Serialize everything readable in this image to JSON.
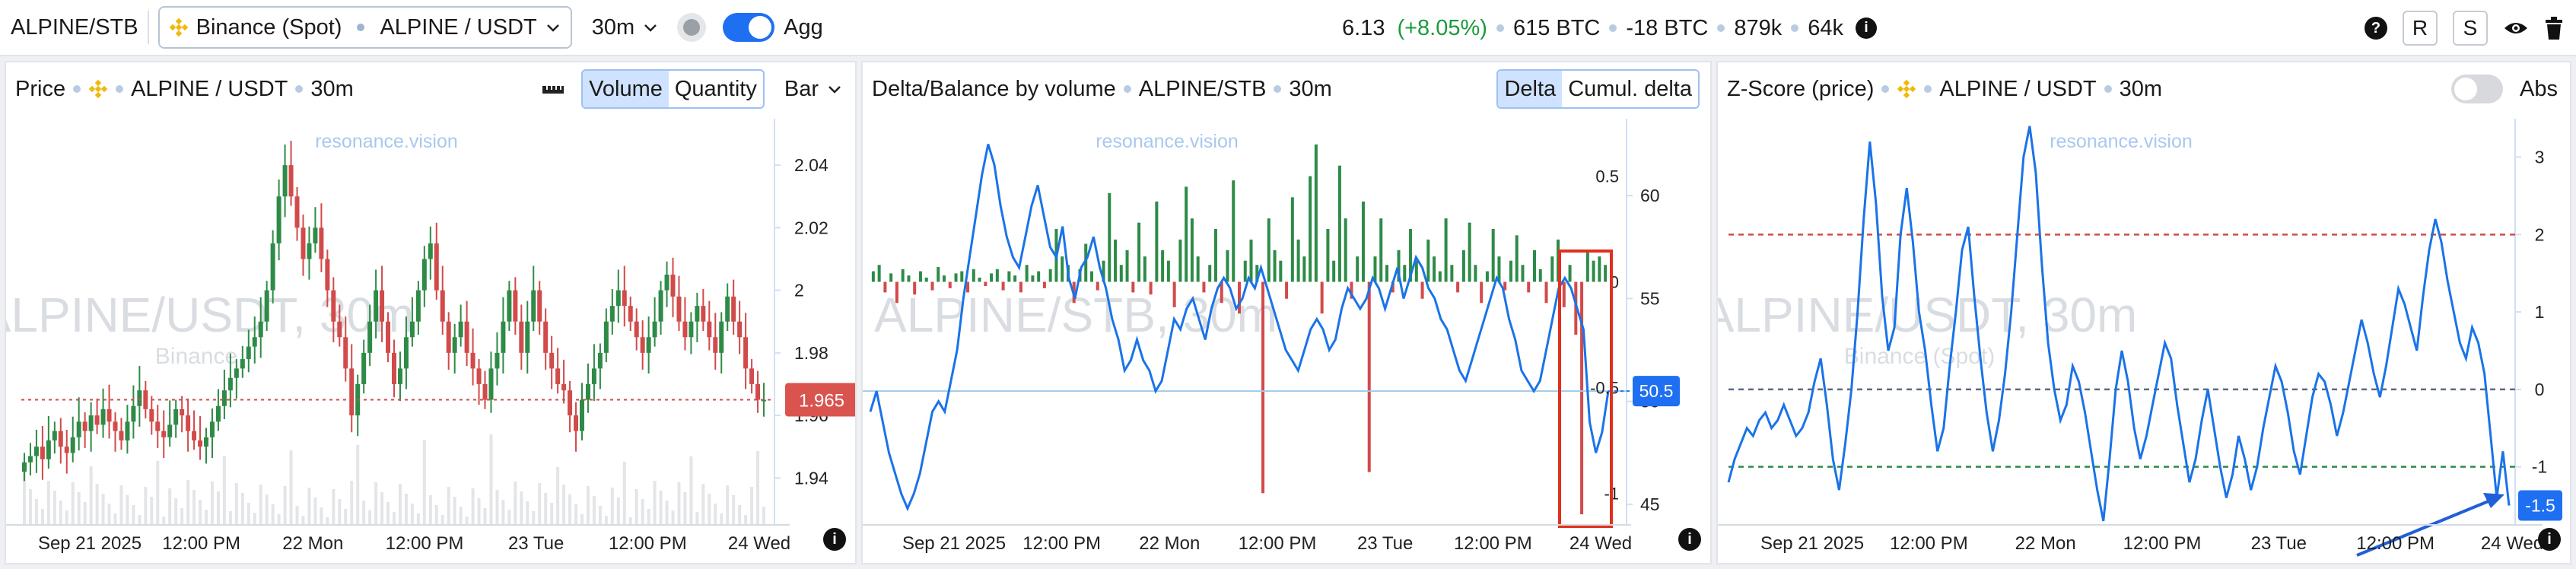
{
  "topbar": {
    "symbol": "ALPINE/STB",
    "exchange": "Binance (Spot)",
    "pair": "ALPINE / USDT",
    "timeframe": "30m",
    "agg_label": "Agg",
    "price": "6.13",
    "change": "(+8.05%)",
    "volume_btc": "615 BTC",
    "delta_btc": "-18 BTC",
    "trades": "879k",
    "count": "64k",
    "btn_r": "R",
    "btn_s": "S",
    "icons": [
      "help-icon",
      "eye-icon",
      "trash-icon"
    ]
  },
  "panels": {
    "price": {
      "title": "Price",
      "pair": "ALPINE / USDT",
      "tf": "30m",
      "volume_btn": "Volume",
      "quantity_btn": "Quantity",
      "type": "Bar",
      "watermark": "resonance.vision",
      "bg_text": "ALPINE/USDT, 30m",
      "bg_sub": "Binance",
      "current_label": "1.965"
    },
    "delta": {
      "title": "Delta/Balance by volume",
      "pair": "ALPINE/STB",
      "tf": "30m",
      "delta_btn": "Delta",
      "cumul_btn": "Cumul. delta",
      "watermark": "resonance.vision",
      "bg_text": "ALPINE/STB, 30m",
      "current_label": "50.5"
    },
    "zscore": {
      "title": "Z-Score (price)",
      "pair": "ALPINE / USDT",
      "tf": "30m",
      "abs_label": "Abs",
      "watermark": "resonance.vision",
      "bg_text": "ALPINE/USDT, 30m",
      "bg_sub": "Binance (Spot)",
      "current_label": "-1.5"
    }
  },
  "colors": {
    "accent": "#1f6ff2",
    "up": "#2e8b47",
    "down": "#d24a4a",
    "line": "#1a73e8"
  },
  "chart_data": [
    {
      "type": "candlestick",
      "x_ticks": [
        "Sep 21 2025",
        "12:00 PM",
        "22 Mon",
        "12:00 PM",
        "23 Tue",
        "12:00 PM",
        "24 Wed"
      ],
      "y_ticks": [
        "2.04",
        "2.02",
        "2",
        "1.98",
        "1.96",
        "1.94"
      ],
      "ylim": [
        1.925,
        2.05
      ],
      "close": [
        1.945,
        1.947,
        1.95,
        1.946,
        1.952,
        1.955,
        1.95,
        1.948,
        1.953,
        1.958,
        1.955,
        1.96,
        1.957,
        1.962,
        1.958,
        1.955,
        1.952,
        1.958,
        1.963,
        1.968,
        1.962,
        1.958,
        1.955,
        1.953,
        1.957,
        1.962,
        1.96,
        1.955,
        1.952,
        1.95,
        1.953,
        1.958,
        1.963,
        1.968,
        1.972,
        1.975,
        1.978,
        1.982,
        1.985,
        1.99,
        2.0,
        2.015,
        2.03,
        2.04,
        2.03,
        2.02,
        2.01,
        2.015,
        2.02,
        2.01,
        2.0,
        1.99,
        1.985,
        1.975,
        1.96,
        1.97,
        1.98,
        1.99,
        2.0,
        1.99,
        1.98,
        1.97,
        1.975,
        1.985,
        1.99,
        2.0,
        2.01,
        2.015,
        2.0,
        1.99,
        1.98,
        1.985,
        1.99,
        1.98,
        1.975,
        1.97,
        1.965,
        1.975,
        1.98,
        1.99,
        2.0,
        1.99,
        1.98,
        1.99,
        2.0,
        1.99,
        1.98,
        1.975,
        1.97,
        1.968,
        1.96,
        1.955,
        1.965,
        1.97,
        1.975,
        1.98,
        1.99,
        1.995,
        2.0,
        1.995,
        1.99,
        1.985,
        1.98,
        1.985,
        1.99,
        2.0,
        2.005,
        1.998,
        1.99,
        1.985,
        1.99,
        1.995,
        1.99,
        1.985,
        1.98,
        1.99,
        1.998,
        1.99,
        1.985,
        1.975,
        1.97,
        1.965,
        1.965
      ]
    },
    {
      "type": "bar+line",
      "left_ticks": [
        "0.5",
        "0",
        "-0.5",
        "-1"
      ],
      "right_ticks": [
        "60",
        "55",
        "50",
        "45"
      ],
      "delta_ylim": [
        -1.15,
        0.7
      ],
      "balance_ylim": [
        44,
        63
      ],
      "delta": [
        0.05,
        0.08,
        -0.05,
        0.04,
        -0.1,
        0.06,
        0.03,
        -0.06,
        0.05,
        0.02,
        -0.04,
        0.07,
        0.03,
        -0.03,
        0.04,
        0.05,
        -0.05,
        0.06,
        0.02,
        -0.02,
        0.04,
        0.06,
        -0.04,
        0.05,
        0.03,
        -0.05,
        0.08,
        0.03,
        0.05,
        -0.03,
        0.06,
        0.25,
        0.12,
        0.08,
        -0.1,
        0.06,
        0.18,
        0.05,
        -0.04,
        0.1,
        0.42,
        0.2,
        0.08,
        0.15,
        -0.05,
        0.28,
        0.12,
        -0.06,
        0.38,
        0.15,
        0.1,
        -0.12,
        0.2,
        0.45,
        0.3,
        0.12,
        -0.05,
        0.08,
        0.25,
        -0.1,
        0.15,
        0.48,
        -0.15,
        0.1,
        0.2,
        0.08,
        -1.0,
        0.3,
        0.15,
        0.1,
        -0.08,
        0.4,
        0.2,
        0.12,
        0.5,
        0.65,
        -0.15,
        0.25,
        0.1,
        0.55,
        0.3,
        -0.08,
        0.12,
        0.38,
        -0.9,
        0.12,
        0.3,
        0.08,
        -0.05,
        0.15,
        0.08,
        0.25,
        0.1,
        -0.08,
        0.2,
        0.12,
        0.05,
        0.3,
        0.08,
        -0.05,
        0.15,
        0.28,
        0.08,
        -0.1,
        0.05,
        0.25,
        0.12,
        -0.04,
        0.1,
        0.22,
        0.08,
        -0.05,
        0.15,
        0.06,
        -0.1,
        0.12,
        0.2,
        -0.12,
        0.08,
        -0.25,
        -1.1,
        0.15,
        0.1,
        0.12,
        0.08
      ],
      "balance": [
        49.5,
        50.5,
        49.0,
        47.5,
        46.5,
        45.5,
        44.8,
        45.5,
        46.5,
        48.0,
        49.5,
        50.0,
        49.5,
        51.0,
        52.5,
        55.0,
        57.0,
        59.0,
        61.0,
        62.5,
        61.5,
        59.5,
        58.0,
        57.0,
        56.5,
        58.0,
        59.5,
        60.5,
        59.0,
        57.5,
        57.0,
        58.5,
        56.0,
        55.0,
        56.5,
        57.0,
        58.0,
        56.5,
        55.5,
        54.0,
        53.0,
        51.5,
        52.0,
        53.0,
        52.0,
        51.5,
        50.5,
        51.0,
        52.5,
        54.0,
        53.5,
        54.5,
        55.0,
        54.0,
        53.0,
        54.5,
        55.5,
        56.0,
        55.5,
        54.5,
        55.0,
        56.0,
        55.5,
        56.5,
        55.5,
        54.5,
        53.5,
        52.5,
        52.0,
        51.5,
        52.5,
        53.5,
        54.0,
        53.5,
        52.5,
        53.0,
        54.5,
        55.5,
        55.0,
        54.5,
        55.0,
        56.0,
        55.5,
        54.5,
        55.5,
        56.5,
        55.0,
        56.0,
        57.0,
        56.5,
        55.5,
        55.0,
        54.0,
        53.5,
        52.5,
        51.5,
        51.0,
        52.0,
        53.0,
        54.0,
        55.0,
        56.0,
        55.5,
        54.0,
        53.0,
        51.5,
        51.0,
        50.5,
        51.0,
        52.5,
        54.0,
        55.5,
        56.0,
        55.5,
        54.5,
        53.5,
        49.0,
        47.5,
        48.5,
        50.5
      ]
    },
    {
      "type": "line",
      "y_ticks": [
        "3",
        "2",
        "1",
        "0",
        "-1"
      ],
      "ylim": [
        -1.75,
        3.3
      ],
      "levels": [
        2,
        0,
        -1
      ],
      "values": [
        -1.2,
        -0.9,
        -0.7,
        -0.5,
        -0.6,
        -0.4,
        -0.3,
        -0.5,
        -0.4,
        -0.2,
        -0.4,
        -0.6,
        -0.5,
        -0.3,
        0.1,
        0.4,
        -0.2,
        -0.9,
        -1.3,
        -0.7,
        0.0,
        1.0,
        2.2,
        3.2,
        2.4,
        1.2,
        0.5,
        0.8,
        2.0,
        2.6,
        1.9,
        1.0,
        0.5,
        -0.2,
        -0.8,
        -0.5,
        0.3,
        1.0,
        1.8,
        2.1,
        1.2,
        0.4,
        -0.3,
        -0.8,
        -0.4,
        0.2,
        1.0,
        2.0,
        3.0,
        3.4,
        2.8,
        1.6,
        0.6,
        0.0,
        -0.4,
        -0.2,
        0.3,
        0.1,
        -0.3,
        -0.8,
        -1.3,
        -1.7,
        -0.9,
        0.0,
        0.5,
        0.1,
        -0.5,
        -0.9,
        -0.6,
        -0.2,
        0.2,
        0.6,
        0.4,
        -0.2,
        -0.7,
        -1.2,
        -0.9,
        -0.4,
        0.0,
        -0.5,
        -1.0,
        -1.4,
        -1.1,
        -0.6,
        -0.9,
        -1.3,
        -1.0,
        -0.5,
        -0.1,
        0.3,
        0.1,
        -0.3,
        -0.8,
        -1.1,
        -0.6,
        -0.1,
        0.2,
        0.1,
        -0.2,
        -0.6,
        -0.3,
        0.1,
        0.5,
        0.9,
        0.6,
        0.2,
        -0.1,
        0.3,
        0.8,
        1.3,
        1.1,
        0.8,
        0.5,
        1.2,
        1.8,
        2.2,
        1.9,
        1.4,
        1.0,
        0.6,
        0.4,
        0.8,
        0.6,
        0.2,
        -0.6,
        -1.4,
        -0.8,
        -1.5
      ]
    }
  ]
}
